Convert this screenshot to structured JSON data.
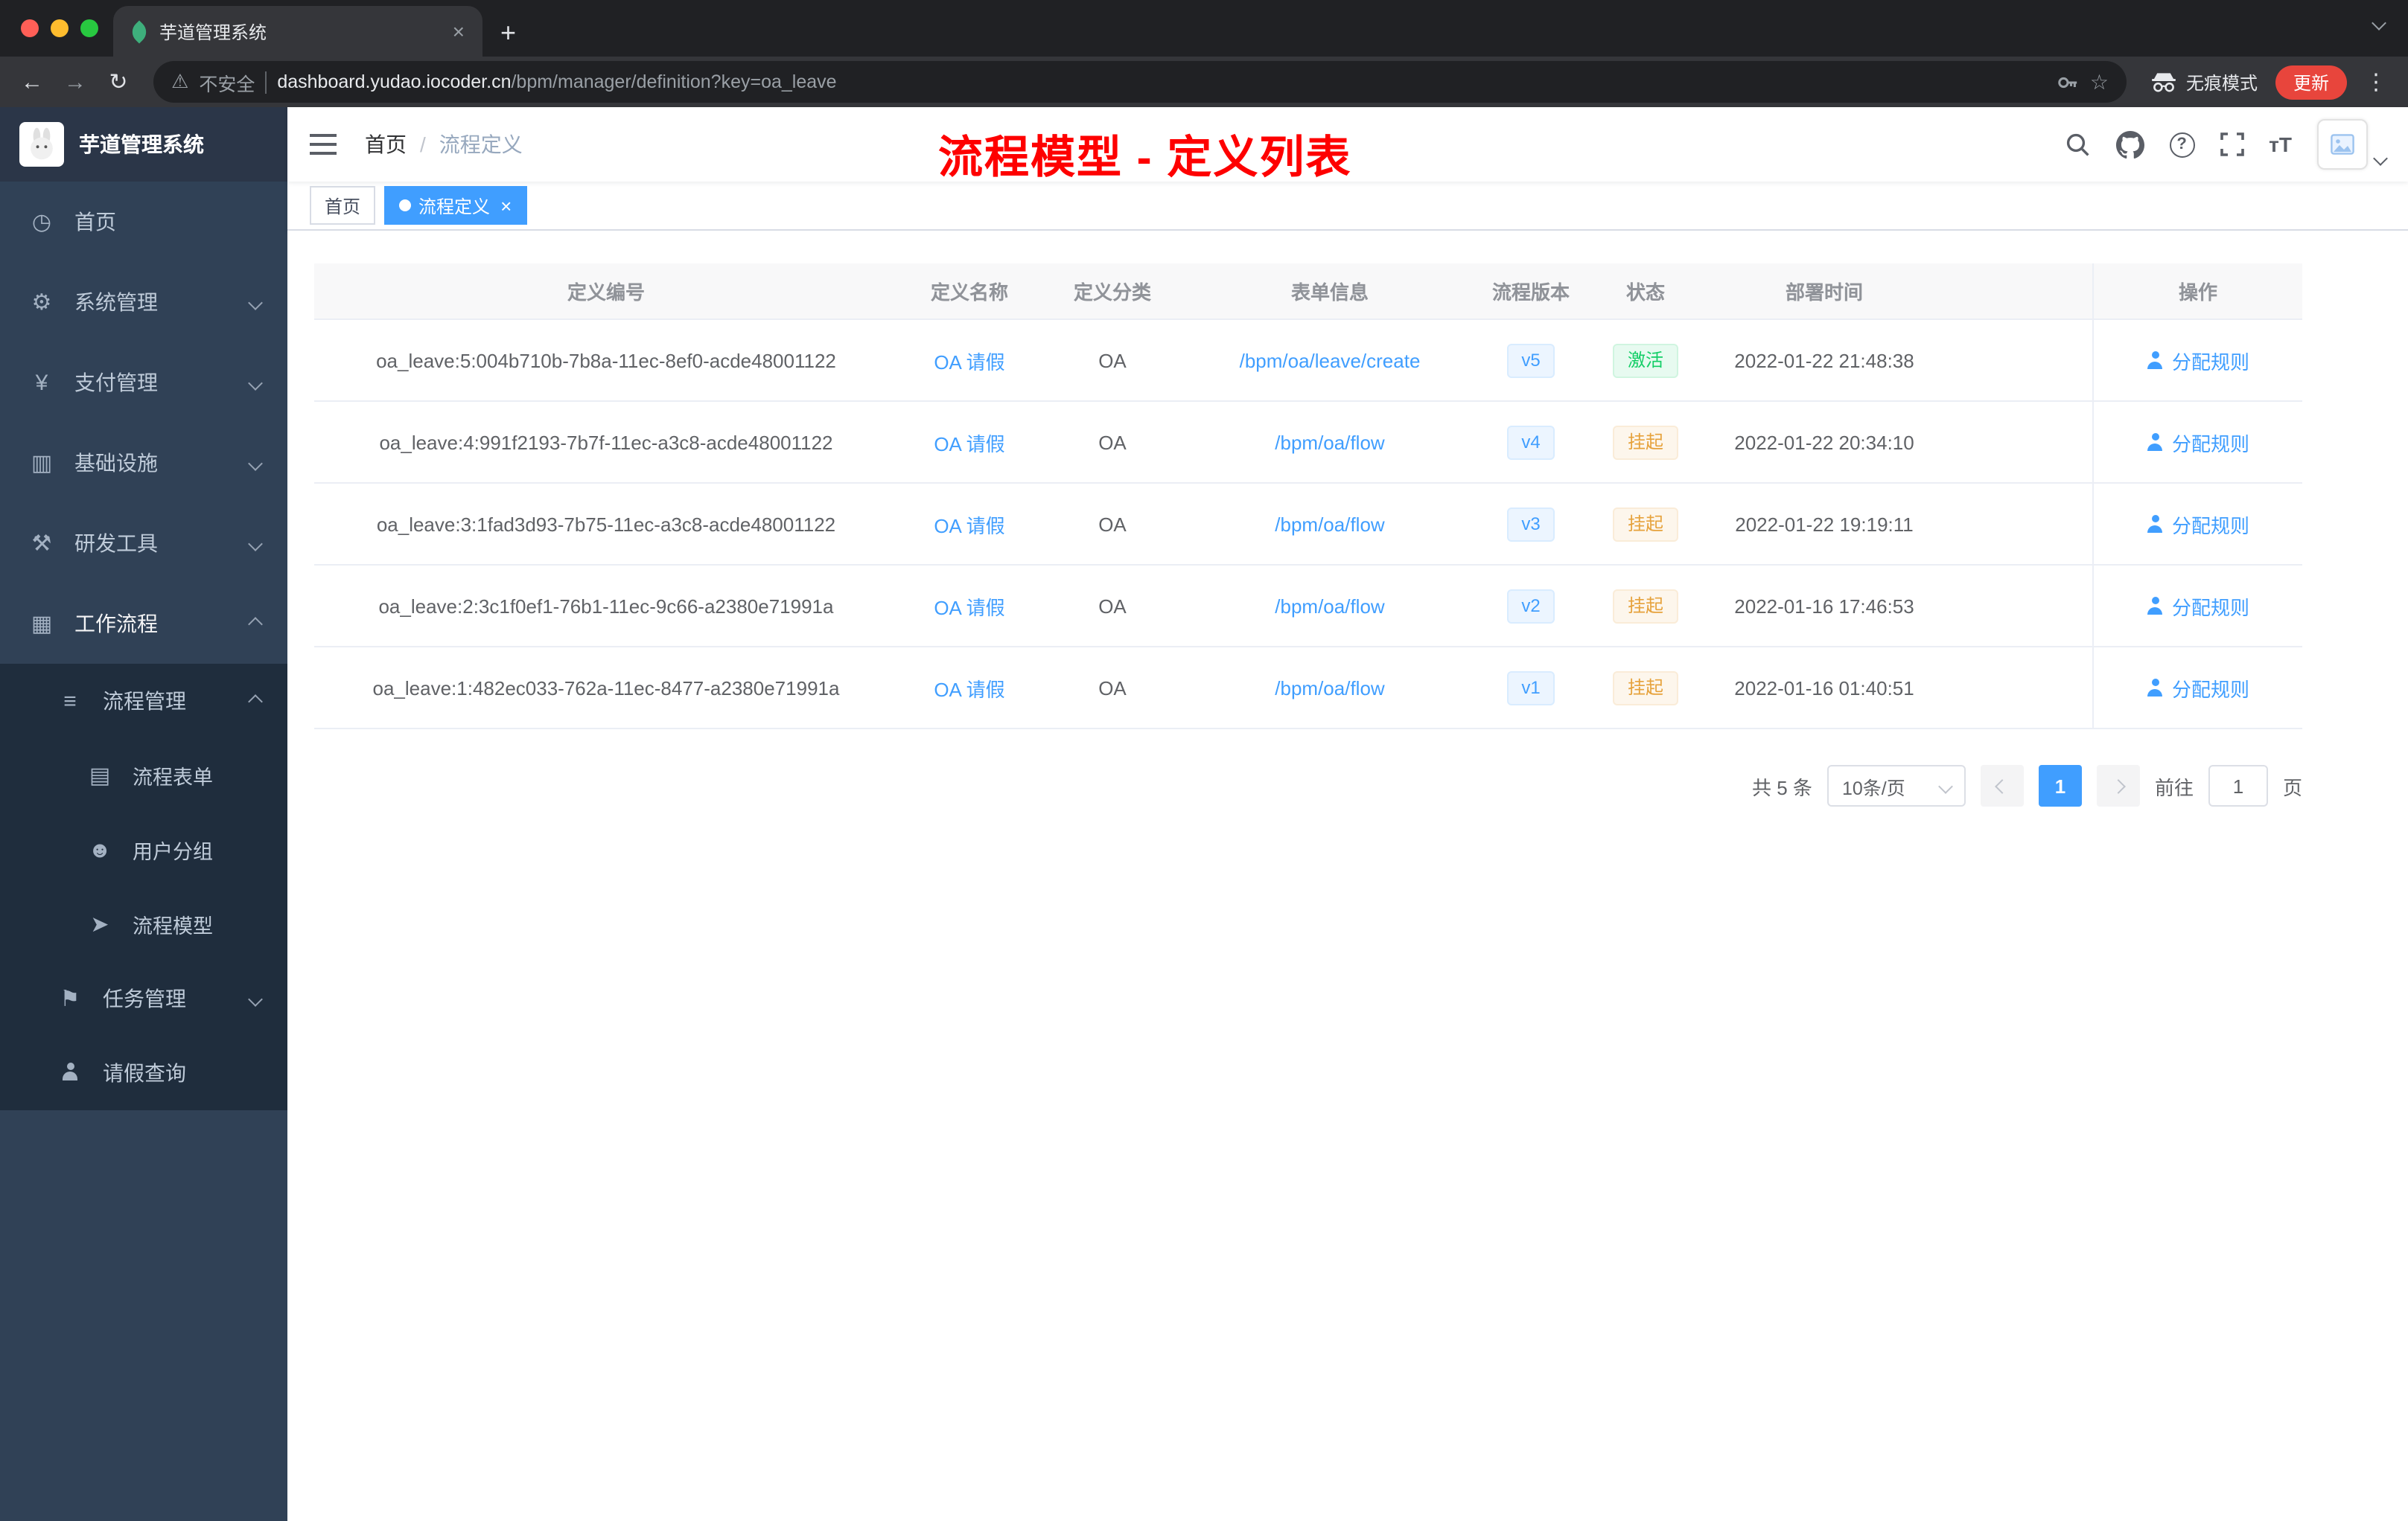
{
  "browser": {
    "tab_title": "芋道管理系统",
    "not_secure": "不安全",
    "url_host": "dashboard.yudao.iocoder.cn",
    "url_path": "/bpm/manager/definition?key=oa_leave",
    "incognito_label": "无痕模式",
    "update_label": "更新"
  },
  "sidebar": {
    "app_title": "芋道管理系统",
    "items": [
      {
        "label": "首页"
      },
      {
        "label": "系统管理"
      },
      {
        "label": "支付管理"
      },
      {
        "label": "基础设施"
      },
      {
        "label": "研发工具"
      },
      {
        "label": "工作流程"
      },
      {
        "label": "流程管理"
      },
      {
        "label": "流程表单"
      },
      {
        "label": "用户分组"
      },
      {
        "label": "流程模型"
      },
      {
        "label": "任务管理"
      },
      {
        "label": "请假查询"
      }
    ]
  },
  "header": {
    "breadcrumb_home": "首页",
    "breadcrumb_separator": "/",
    "breadcrumb_current": "流程定义",
    "annotation": "流程模型 - 定义列表"
  },
  "tags": [
    {
      "label": "首页"
    },
    {
      "label": "流程定义"
    }
  ],
  "table": {
    "columns": [
      "定义编号",
      "定义名称",
      "定义分类",
      "表单信息",
      "流程版本",
      "状态",
      "部署时间",
      "操作"
    ],
    "rows": [
      {
        "id": "oa_leave:5:004b710b-7b8a-11ec-8ef0-acde48001122",
        "name": "OA 请假",
        "category": "OA",
        "form": "/bpm/oa/leave/create",
        "version": "v5",
        "status": "激活",
        "time": "2022-01-22 21:48:38",
        "action": "分配规则"
      },
      {
        "id": "oa_leave:4:991f2193-7b7f-11ec-a3c8-acde48001122",
        "name": "OA 请假",
        "category": "OA",
        "form": "/bpm/oa/flow",
        "version": "v4",
        "status": "挂起",
        "time": "2022-01-22 20:34:10",
        "action": "分配规则"
      },
      {
        "id": "oa_leave:3:1fad3d93-7b75-11ec-a3c8-acde48001122",
        "name": "OA 请假",
        "category": "OA",
        "form": "/bpm/oa/flow",
        "version": "v3",
        "status": "挂起",
        "time": "2022-01-22 19:19:11",
        "action": "分配规则"
      },
      {
        "id": "oa_leave:2:3c1f0ef1-76b1-11ec-9c66-a2380e71991a",
        "name": "OA 请假",
        "category": "OA",
        "form": "/bpm/oa/flow",
        "version": "v2",
        "status": "挂起",
        "time": "2022-01-16 17:46:53",
        "action": "分配规则"
      },
      {
        "id": "oa_leave:1:482ec033-762a-11ec-8477-a2380e71991a",
        "name": "OA 请假",
        "category": "OA",
        "form": "/bpm/oa/flow",
        "version": "v1",
        "status": "挂起",
        "time": "2022-01-16 01:40:51",
        "action": "分配规则"
      }
    ]
  },
  "pagination": {
    "total": "共 5 条",
    "page_size": "10条/页",
    "current_page": "1",
    "goto_label": "前往",
    "goto_value": "1",
    "page_unit": "页"
  },
  "colors": {
    "accent": "#409eff",
    "success": "#13ce66",
    "warning": "#e6a23c",
    "annotation_red": "#fe0000"
  }
}
